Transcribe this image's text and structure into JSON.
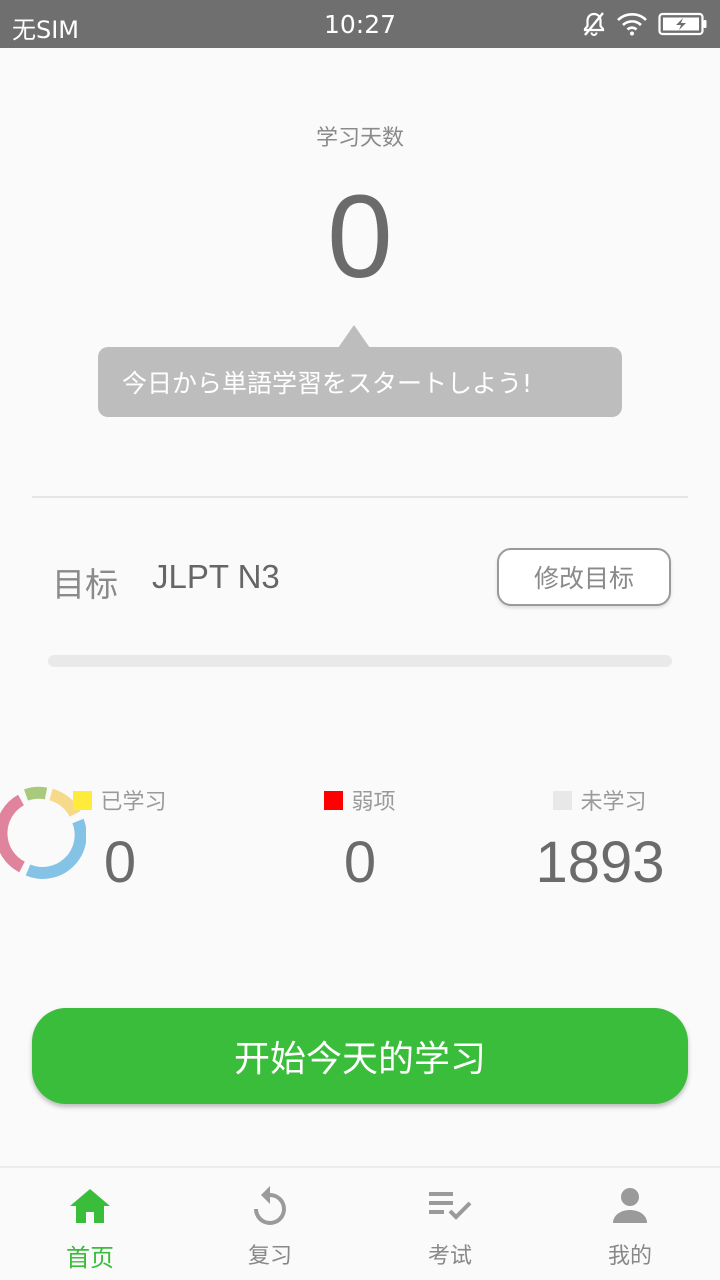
{
  "status_bar": {
    "carrier": "无SIM",
    "time": "10:27",
    "icons": [
      "mute-bell-icon",
      "wifi-icon",
      "battery-charging-icon"
    ]
  },
  "study_days": {
    "label": "学习天数",
    "value": "0"
  },
  "tooltip": {
    "text": "今日から単語学習をスタートしよう!"
  },
  "goal": {
    "label": "目标",
    "value": "JLPT N3",
    "edit_button": "修改目标",
    "progress": 0
  },
  "stats": {
    "ring_colors": [
      "#a9c97c",
      "#f7d98c",
      "#85c3e6",
      "#e0849e"
    ],
    "learned": {
      "label": "已学习",
      "value": "0",
      "color": "#ffeb3b"
    },
    "weak": {
      "label": "弱项",
      "value": "0",
      "color": "#ff0000"
    },
    "unlearned": {
      "label": "未学习",
      "value": "1893",
      "color": "#e8e8e8"
    }
  },
  "start_button": "开始今天的学习",
  "tabs": [
    {
      "label": "首页",
      "icon": "home-icon",
      "active": true
    },
    {
      "label": "复习",
      "icon": "review-icon",
      "active": false
    },
    {
      "label": "考试",
      "icon": "exam-icon",
      "active": false
    },
    {
      "label": "我的",
      "icon": "profile-icon",
      "active": false
    }
  ],
  "colors": {
    "accent": "#39bd3a",
    "status_bar": "#6f6f6f"
  }
}
